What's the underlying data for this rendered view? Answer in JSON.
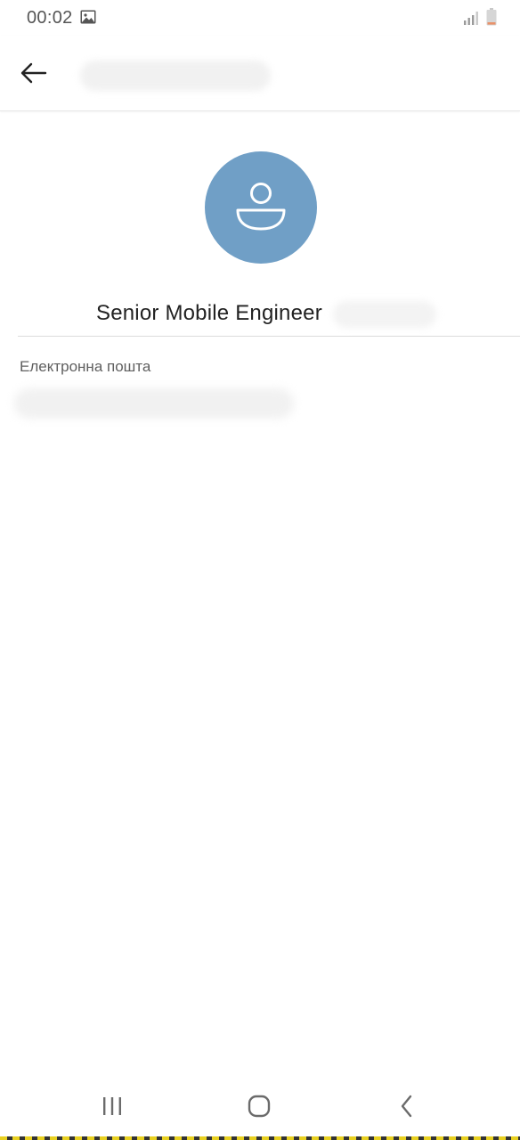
{
  "status_bar": {
    "time": "00:02",
    "icons": [
      "gallery-icon",
      "signal-icon",
      "battery-icon"
    ]
  },
  "app_bar": {
    "back_icon": "arrow-left-icon"
  },
  "profile": {
    "avatar_color": "#709fc6",
    "avatar_icon": "person-icon",
    "name": "Senior Mobile Engineer"
  },
  "email_section": {
    "label": "Електронна пошта"
  },
  "nav_bar": {
    "items": [
      "recents-icon",
      "home-icon",
      "back-icon"
    ]
  }
}
